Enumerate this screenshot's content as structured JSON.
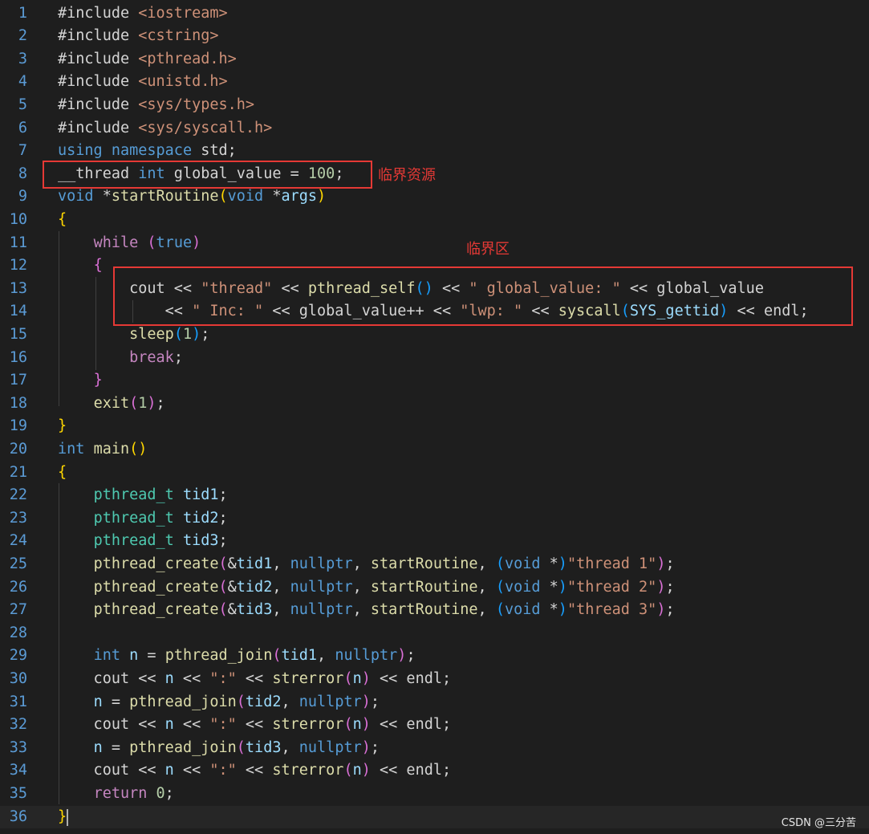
{
  "lines": [
    {
      "n": "1",
      "t": [
        [
          "pp",
          "#include "
        ],
        [
          "str",
          "<iostream>"
        ]
      ]
    },
    {
      "n": "2",
      "t": [
        [
          "pp",
          "#include "
        ],
        [
          "str",
          "<cstring>"
        ]
      ]
    },
    {
      "n": "3",
      "t": [
        [
          "pp",
          "#include "
        ],
        [
          "str",
          "<pthread.h>"
        ]
      ]
    },
    {
      "n": "4",
      "t": [
        [
          "pp",
          "#include "
        ],
        [
          "str",
          "<unistd.h>"
        ]
      ]
    },
    {
      "n": "5",
      "t": [
        [
          "pp",
          "#include "
        ],
        [
          "str",
          "<sys/types.h>"
        ]
      ]
    },
    {
      "n": "6",
      "t": [
        [
          "pp",
          "#include "
        ],
        [
          "str",
          "<sys/syscall.h>"
        ]
      ]
    },
    {
      "n": "7",
      "t": [
        [
          "kw",
          "using"
        ],
        [
          "",
          " "
        ],
        [
          "kw",
          "namespace"
        ],
        [
          "",
          " std;"
        ]
      ]
    },
    {
      "n": "8",
      "t": [
        [
          "",
          "__thread "
        ],
        [
          "kw",
          "int"
        ],
        [
          "",
          " global_value = "
        ],
        [
          "num",
          "100"
        ],
        [
          "",
          ";"
        ]
      ]
    },
    {
      "n": "9",
      "t": [
        [
          "kw",
          "void"
        ],
        [
          "",
          " *"
        ],
        [
          "fn",
          "startRoutine"
        ],
        [
          "p1",
          "("
        ],
        [
          "kw",
          "void"
        ],
        [
          "",
          " *"
        ],
        [
          "var",
          "args"
        ],
        [
          "p1",
          ")"
        ]
      ]
    },
    {
      "n": "10",
      "t": [
        [
          "p1",
          "{"
        ]
      ]
    },
    {
      "n": "11",
      "t": [
        [
          "",
          "    "
        ],
        [
          "ctrl",
          "while"
        ],
        [
          "",
          " "
        ],
        [
          "p2",
          "("
        ],
        [
          "kw",
          "true"
        ],
        [
          "p2",
          ")"
        ]
      ]
    },
    {
      "n": "12",
      "t": [
        [
          "",
          "    "
        ],
        [
          "p2",
          "{"
        ]
      ]
    },
    {
      "n": "13",
      "t": [
        [
          "",
          "        cout << "
        ],
        [
          "str",
          "\"thread\""
        ],
        [
          "",
          " << "
        ],
        [
          "fn",
          "pthread_self"
        ],
        [
          "p3",
          "()"
        ],
        [
          "",
          " << "
        ],
        [
          "str",
          "\" global_value: \""
        ],
        [
          "",
          " << global_value"
        ]
      ]
    },
    {
      "n": "14",
      "t": [
        [
          "",
          "            << "
        ],
        [
          "str",
          "\" Inc: \""
        ],
        [
          "",
          " << global_value++ << "
        ],
        [
          "str",
          "\"lwp: \""
        ],
        [
          "",
          " << "
        ],
        [
          "fn",
          "syscall"
        ],
        [
          "p3",
          "("
        ],
        [
          "var",
          "SYS_gettid"
        ],
        [
          "p3",
          ")"
        ],
        [
          "",
          " << endl;"
        ]
      ]
    },
    {
      "n": "15",
      "t": [
        [
          "",
          "        "
        ],
        [
          "fn",
          "sleep"
        ],
        [
          "p3",
          "("
        ],
        [
          "num",
          "1"
        ],
        [
          "p3",
          ")"
        ],
        [
          "",
          ";"
        ]
      ]
    },
    {
      "n": "16",
      "t": [
        [
          "",
          "        "
        ],
        [
          "ctrl",
          "break"
        ],
        [
          "",
          ";"
        ]
      ]
    },
    {
      "n": "17",
      "t": [
        [
          "",
          "    "
        ],
        [
          "p2",
          "}"
        ]
      ]
    },
    {
      "n": "18",
      "t": [
        [
          "",
          "    "
        ],
        [
          "fn",
          "exit"
        ],
        [
          "p2",
          "("
        ],
        [
          "num",
          "1"
        ],
        [
          "p2",
          ")"
        ],
        [
          "",
          ";"
        ]
      ]
    },
    {
      "n": "19",
      "t": [
        [
          "p1",
          "}"
        ]
      ]
    },
    {
      "n": "20",
      "t": [
        [
          "kw",
          "int"
        ],
        [
          "",
          " "
        ],
        [
          "fn",
          "main"
        ],
        [
          "p1",
          "()"
        ]
      ]
    },
    {
      "n": "21",
      "t": [
        [
          "p1",
          "{"
        ]
      ]
    },
    {
      "n": "22",
      "t": [
        [
          "",
          "    "
        ],
        [
          "ty",
          "pthread_t"
        ],
        [
          "",
          " "
        ],
        [
          "var",
          "tid1"
        ],
        [
          "",
          ";"
        ]
      ]
    },
    {
      "n": "23",
      "t": [
        [
          "",
          "    "
        ],
        [
          "ty",
          "pthread_t"
        ],
        [
          "",
          " "
        ],
        [
          "var",
          "tid2"
        ],
        [
          "",
          ";"
        ]
      ]
    },
    {
      "n": "24",
      "t": [
        [
          "",
          "    "
        ],
        [
          "ty",
          "pthread_t"
        ],
        [
          "",
          " "
        ],
        [
          "var",
          "tid3"
        ],
        [
          "",
          ";"
        ]
      ]
    },
    {
      "n": "25",
      "t": [
        [
          "",
          "    "
        ],
        [
          "fn",
          "pthread_create"
        ],
        [
          "p2",
          "("
        ],
        [
          "",
          "&"
        ],
        [
          "var",
          "tid1"
        ],
        [
          "",
          ", "
        ],
        [
          "kw",
          "nullptr"
        ],
        [
          "",
          ", "
        ],
        [
          "fn",
          "startRoutine"
        ],
        [
          "",
          ", "
        ],
        [
          "p3",
          "("
        ],
        [
          "kw",
          "void"
        ],
        [
          "",
          " *"
        ],
        [
          "p3",
          ")"
        ],
        [
          "str",
          "\"thread 1\""
        ],
        [
          "p2",
          ")"
        ],
        [
          "",
          ";"
        ]
      ]
    },
    {
      "n": "26",
      "t": [
        [
          "",
          "    "
        ],
        [
          "fn",
          "pthread_create"
        ],
        [
          "p2",
          "("
        ],
        [
          "",
          "&"
        ],
        [
          "var",
          "tid2"
        ],
        [
          "",
          ", "
        ],
        [
          "kw",
          "nullptr"
        ],
        [
          "",
          ", "
        ],
        [
          "fn",
          "startRoutine"
        ],
        [
          "",
          ", "
        ],
        [
          "p3",
          "("
        ],
        [
          "kw",
          "void"
        ],
        [
          "",
          " *"
        ],
        [
          "p3",
          ")"
        ],
        [
          "str",
          "\"thread 2\""
        ],
        [
          "p2",
          ")"
        ],
        [
          "",
          ";"
        ]
      ]
    },
    {
      "n": "27",
      "t": [
        [
          "",
          "    "
        ],
        [
          "fn",
          "pthread_create"
        ],
        [
          "p2",
          "("
        ],
        [
          "",
          "&"
        ],
        [
          "var",
          "tid3"
        ],
        [
          "",
          ", "
        ],
        [
          "kw",
          "nullptr"
        ],
        [
          "",
          ", "
        ],
        [
          "fn",
          "startRoutine"
        ],
        [
          "",
          ", "
        ],
        [
          "p3",
          "("
        ],
        [
          "kw",
          "void"
        ],
        [
          "",
          " *"
        ],
        [
          "p3",
          ")"
        ],
        [
          "str",
          "\"thread 3\""
        ],
        [
          "p2",
          ")"
        ],
        [
          "",
          ";"
        ]
      ]
    },
    {
      "n": "28",
      "t": []
    },
    {
      "n": "29",
      "t": [
        [
          "",
          "    "
        ],
        [
          "kw",
          "int"
        ],
        [
          "",
          " "
        ],
        [
          "var",
          "n"
        ],
        [
          "",
          " = "
        ],
        [
          "fn",
          "pthread_join"
        ],
        [
          "p2",
          "("
        ],
        [
          "var",
          "tid1"
        ],
        [
          "",
          ", "
        ],
        [
          "kw",
          "nullptr"
        ],
        [
          "p2",
          ")"
        ],
        [
          "",
          ";"
        ]
      ]
    },
    {
      "n": "30",
      "t": [
        [
          "",
          "    cout << "
        ],
        [
          "var",
          "n"
        ],
        [
          "",
          " << "
        ],
        [
          "str",
          "\":\""
        ],
        [
          "",
          " << "
        ],
        [
          "fn",
          "strerror"
        ],
        [
          "p2",
          "("
        ],
        [
          "var",
          "n"
        ],
        [
          "p2",
          ")"
        ],
        [
          "",
          " << endl;"
        ]
      ]
    },
    {
      "n": "31",
      "t": [
        [
          "",
          "    "
        ],
        [
          "var",
          "n"
        ],
        [
          "",
          " = "
        ],
        [
          "fn",
          "pthread_join"
        ],
        [
          "p2",
          "("
        ],
        [
          "var",
          "tid2"
        ],
        [
          "",
          ", "
        ],
        [
          "kw",
          "nullptr"
        ],
        [
          "p2",
          ")"
        ],
        [
          "",
          ";"
        ]
      ]
    },
    {
      "n": "32",
      "t": [
        [
          "",
          "    cout << "
        ],
        [
          "var",
          "n"
        ],
        [
          "",
          " << "
        ],
        [
          "str",
          "\":\""
        ],
        [
          "",
          " << "
        ],
        [
          "fn",
          "strerror"
        ],
        [
          "p2",
          "("
        ],
        [
          "var",
          "n"
        ],
        [
          "p2",
          ")"
        ],
        [
          "",
          " << endl;"
        ]
      ]
    },
    {
      "n": "33",
      "t": [
        [
          "",
          "    "
        ],
        [
          "var",
          "n"
        ],
        [
          "",
          " = "
        ],
        [
          "fn",
          "pthread_join"
        ],
        [
          "p2",
          "("
        ],
        [
          "var",
          "tid3"
        ],
        [
          "",
          ", "
        ],
        [
          "kw",
          "nullptr"
        ],
        [
          "p2",
          ")"
        ],
        [
          "",
          ";"
        ]
      ]
    },
    {
      "n": "34",
      "t": [
        [
          "",
          "    cout << "
        ],
        [
          "var",
          "n"
        ],
        [
          "",
          " << "
        ],
        [
          "str",
          "\":\""
        ],
        [
          "",
          " << "
        ],
        [
          "fn",
          "strerror"
        ],
        [
          "p2",
          "("
        ],
        [
          "var",
          "n"
        ],
        [
          "p2",
          ")"
        ],
        [
          "",
          " << endl;"
        ]
      ]
    },
    {
      "n": "35",
      "t": [
        [
          "",
          "    "
        ],
        [
          "ctrl",
          "return"
        ],
        [
          "",
          " "
        ],
        [
          "num",
          "0"
        ],
        [
          "",
          ";"
        ]
      ]
    },
    {
      "n": "36",
      "t": [
        [
          "p1",
          "}"
        ]
      ]
    }
  ],
  "annotations": {
    "critical_resource": "临界资源",
    "critical_section": "临界区"
  },
  "watermark": "CSDN @三分苦",
  "colors": {
    "background": "#1e1e1e",
    "line_number": "#5b9bd5",
    "annotation_red": "#e53935"
  }
}
